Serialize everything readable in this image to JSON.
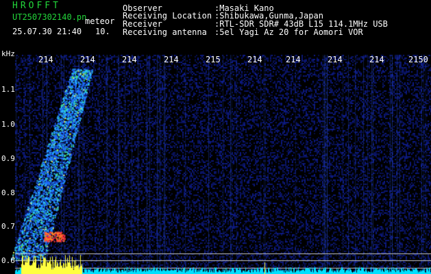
{
  "header": {
    "logo": "HROFFT",
    "filename": "UT2507302140.pn",
    "mode": "meteor",
    "datetime": "25.07.30 21:40",
    "count": "10.",
    "info": [
      {
        "label": "Observer",
        "value": ":Masaki Kano"
      },
      {
        "label": "Receiving Location",
        "value": ":Shibukawa,Gunma,Japan"
      },
      {
        "label": "Receiver",
        "value": ":RTL-SDR SDR# 43dB L15 114.1MHz USB"
      },
      {
        "label": "Receiving antenna",
        "value": ":5el Yagi Az 20 for Aomori VOR"
      }
    ]
  },
  "axes": {
    "y_unit": "kHz",
    "y_labels": [
      "1.1",
      "1.0",
      "0.9",
      "0.8",
      "0.7",
      "0.6"
    ],
    "time_labels": [
      "214",
      "214",
      "214",
      "214",
      "215",
      "214",
      "214",
      "214",
      "214",
      "2150"
    ]
  },
  "colors": {
    "text_green": "#22d63a",
    "text_white": "#ffffff",
    "background": "#000000",
    "noise": "#0a1a6a",
    "echo": "#1fa0ff",
    "echo_hot": "#ff3040",
    "baseline": "#ffff40",
    "baseline_cyan": "#00e0ff"
  }
}
